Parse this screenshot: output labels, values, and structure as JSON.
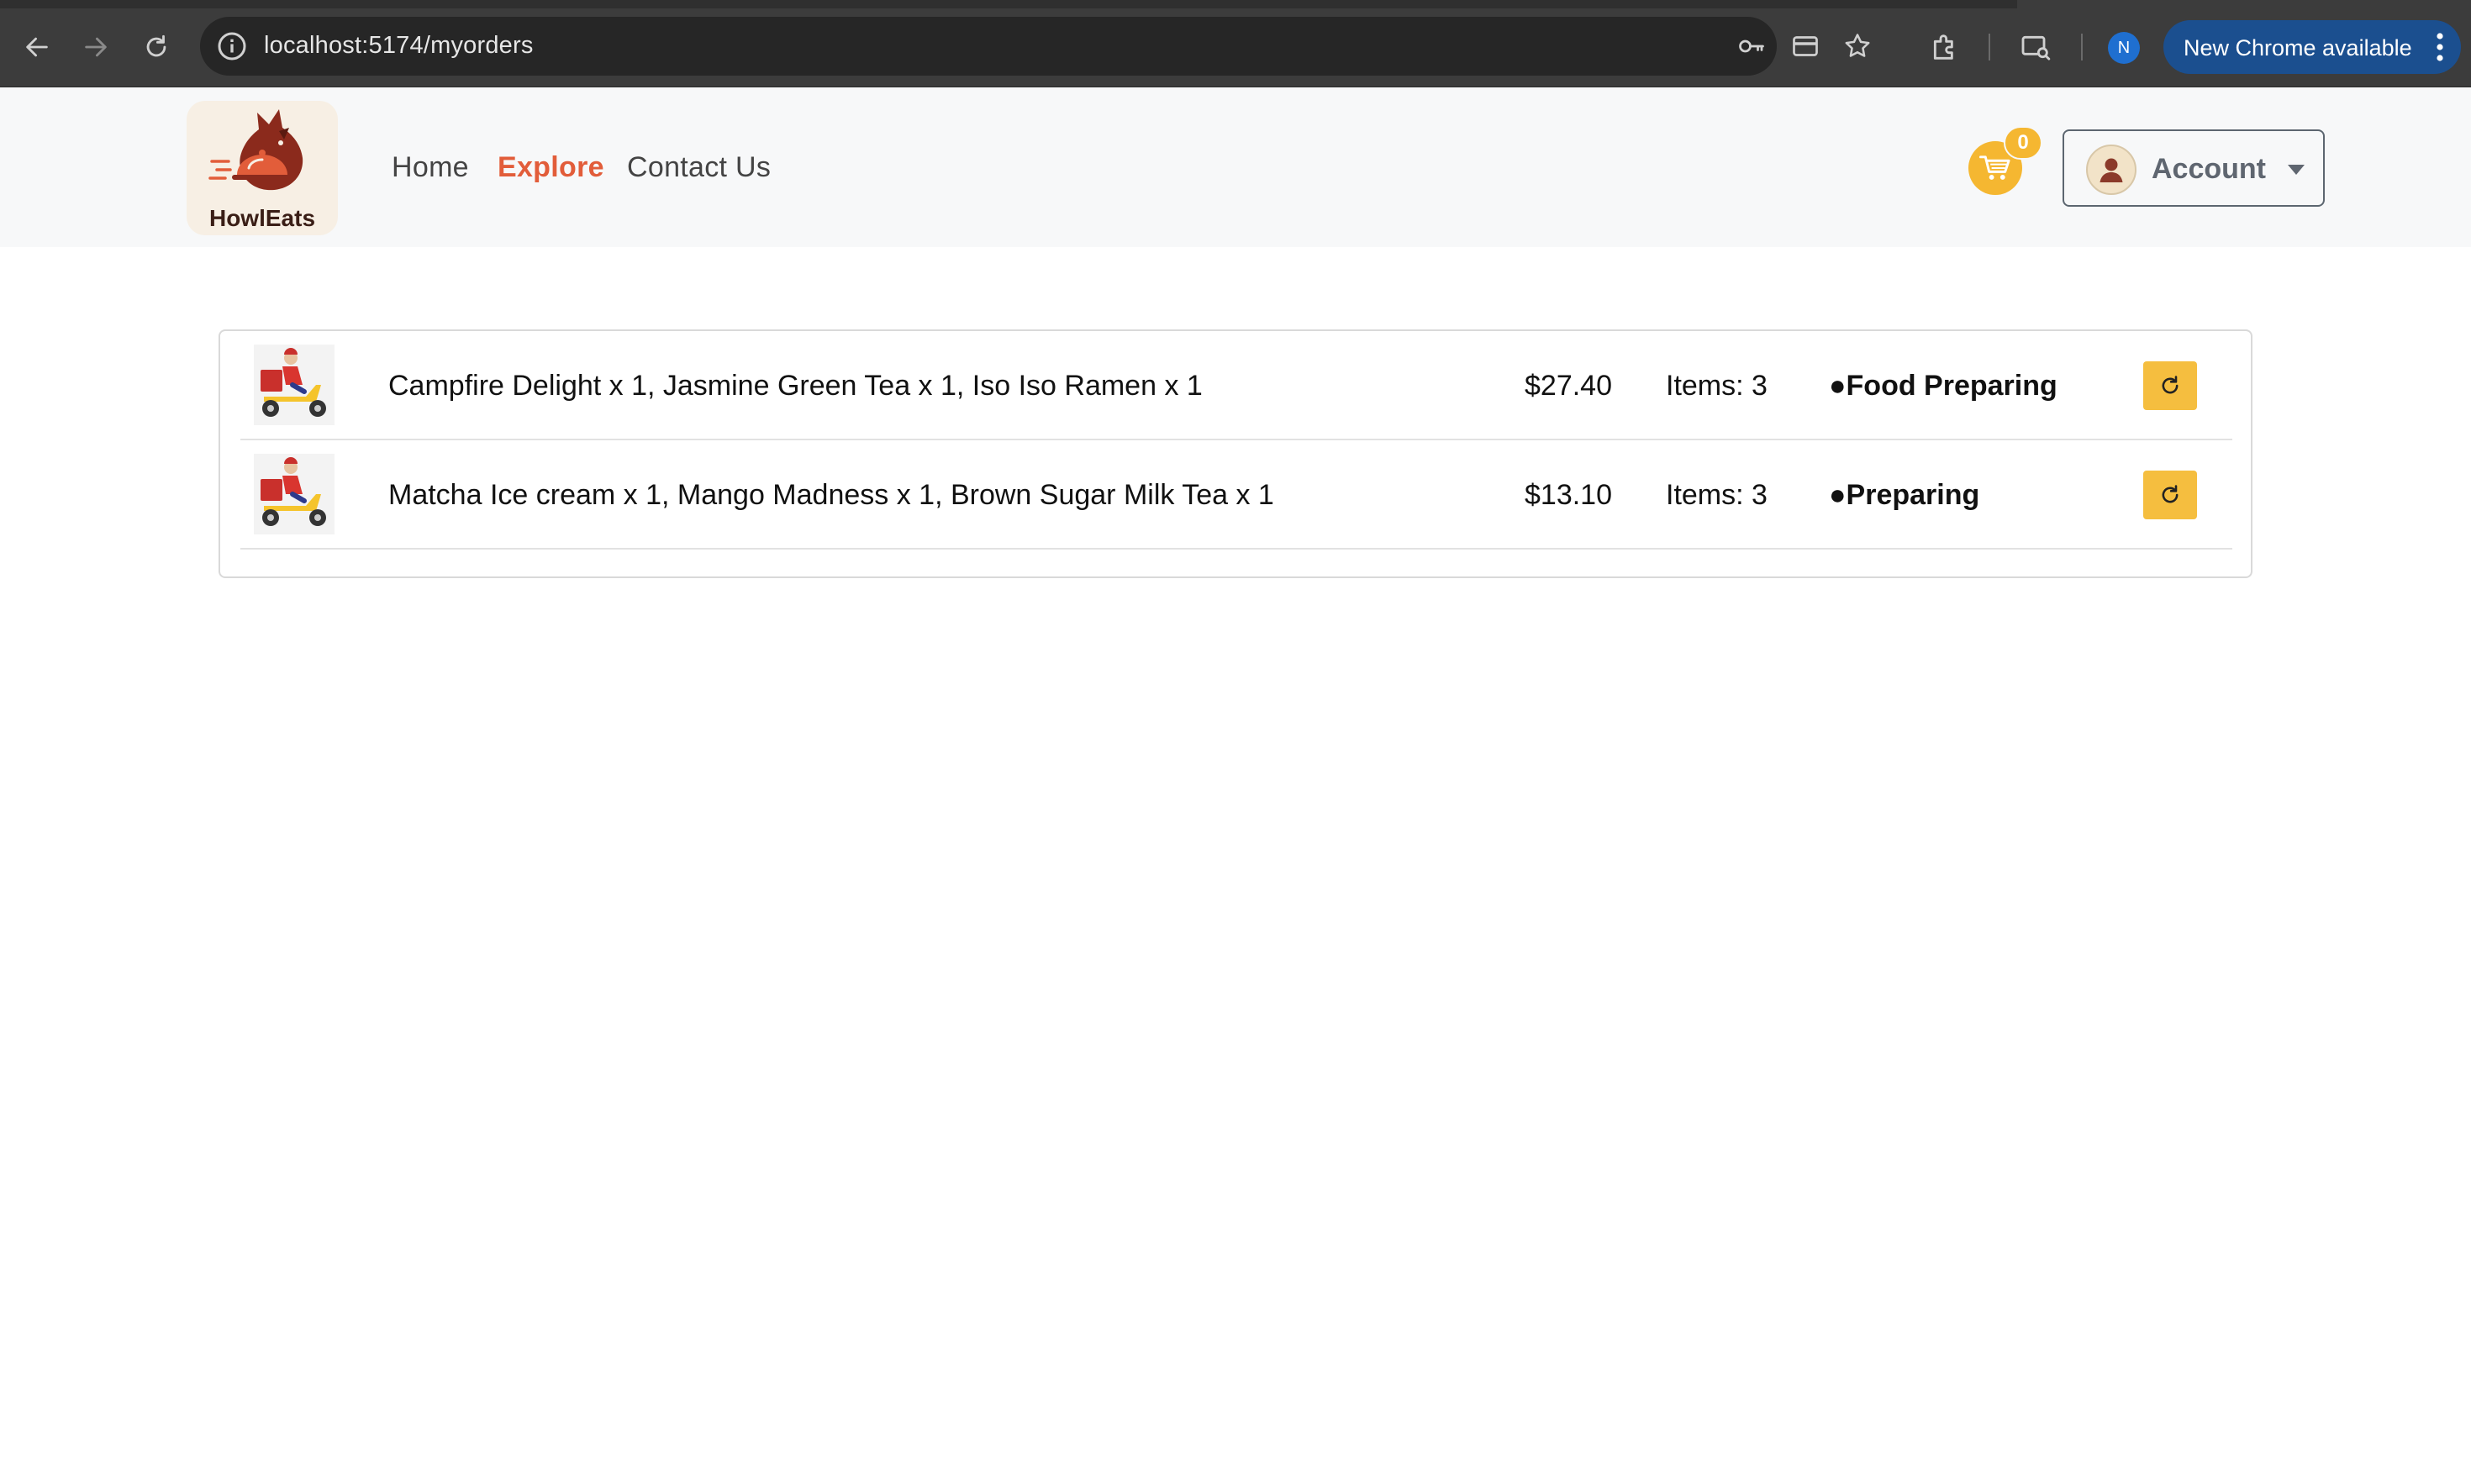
{
  "browser": {
    "url": "localhost:5174/myorders",
    "profile_initial": "N",
    "update_label": "New Chrome available"
  },
  "header": {
    "logo_text": "HowlEats",
    "nav": [
      {
        "label": "Home",
        "active": false
      },
      {
        "label": "Explore",
        "active": true
      },
      {
        "label": "Contact Us",
        "active": false
      }
    ],
    "cart_count": "0",
    "account_label": "Account"
  },
  "orders": [
    {
      "items": "Campfire Delight x 1, Jasmine Green Tea x 1, Iso Iso Ramen x 1",
      "amount": "$27.40",
      "count": "Items: 3",
      "status": "●Food Preparing"
    },
    {
      "items": "Matcha Ice cream x 1, Mango Madness x 1, Brown Sugar Milk Tea x 1",
      "amount": "$13.10",
      "count": "Items: 3",
      "status": "●Preparing"
    }
  ],
  "colors": {
    "accent": "#e25d3a",
    "cart_yellow": "#f5b731",
    "refresh_yellow": "#f5be3f",
    "header_bg": "#f7f8f9"
  }
}
